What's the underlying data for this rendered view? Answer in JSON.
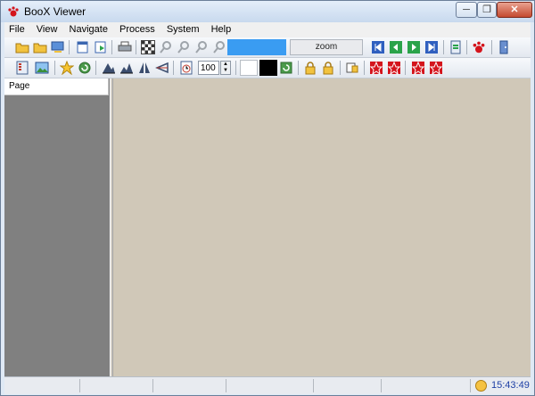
{
  "window": {
    "title": "BooX Viewer"
  },
  "window_controls": {
    "minimize": "─",
    "restore": "❐",
    "close": "✕"
  },
  "menu": [
    "File",
    "View",
    "Navigate",
    "Process",
    "System",
    "Help"
  ],
  "toolbar1": {
    "zoom_label": "zoom",
    "icons": [
      "open-folder-icon",
      "open-folder-icon",
      "open-monitor-icon",
      "new-page-icon",
      "export-icon",
      "print-icon",
      "checker-pattern-icon",
      "zoom-in-icon",
      "zoom-out-icon",
      "zoom-fit-icon",
      "zoom-reset-icon",
      "first-page-icon",
      "prev-page-icon",
      "next-page-icon",
      "last-page-icon",
      "book-icon",
      "paw-icon",
      "exit-icon"
    ]
  },
  "toolbar2": {
    "number_value": "100",
    "icons": [
      "layers-icon",
      "picture-icon",
      "star-icon",
      "refresh-icon",
      "mountain-icon",
      "mountain-icon",
      "mirror-icon",
      "flip-icon",
      "timer-icon",
      "rotate-icon",
      "lock-icon",
      "lock-icon",
      "stamp-icon",
      "red-star-icon",
      "red-star-icon",
      "red-star-icon",
      "red-star-icon"
    ]
  },
  "sidebar": {
    "header": "Page"
  },
  "status": {
    "time": "15:43:49"
  },
  "colors": {
    "zoom_bar": "#3a9cf2",
    "viewer_bg": "#d0c8b8",
    "sidebar_bg": "#808080",
    "clock_text": "#1d3fa5"
  }
}
